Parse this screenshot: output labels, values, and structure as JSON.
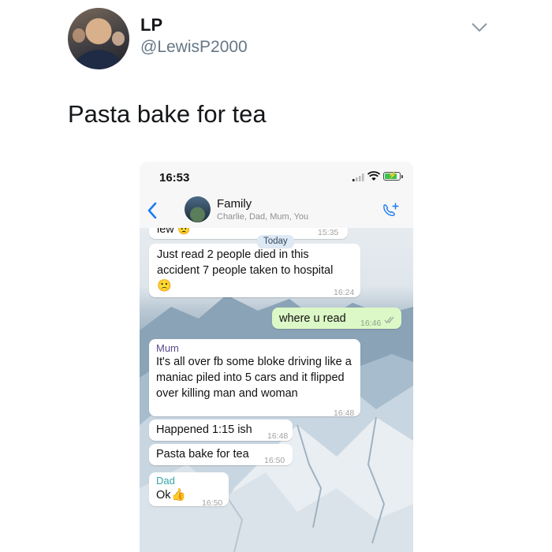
{
  "tweet": {
    "name": "LP",
    "handle": "@LewisP2000",
    "text": "Pasta bake for tea"
  },
  "phone": {
    "status_time": "16:53",
    "chat": {
      "group_name": "Family",
      "members": "Charlie, Dad, Mum, You",
      "date_divider": "Today",
      "messages": [
        {
          "text": "iew",
          "emoji": "😟",
          "time": "15:35",
          "direction": "in"
        },
        {
          "text": "Just read 2 people died in this accident 7 people taken to hospital",
          "emoji": "🙁",
          "time": "16:24",
          "direction": "in"
        },
        {
          "text": "where u read",
          "time": "16:46",
          "direction": "out",
          "status": "read"
        },
        {
          "sender": "Mum",
          "text": "It's all over fb some bloke driving like a maniac piled into 5 cars and it flipped over killing man and woman",
          "time": "16:48",
          "direction": "in"
        },
        {
          "text": "Happened 1:15 ish",
          "time": "16:48",
          "direction": "in"
        },
        {
          "text": "Pasta bake for tea",
          "time": "16:50",
          "direction": "in"
        },
        {
          "sender": "Dad",
          "text": "Ok",
          "emoji": "👍",
          "time": "16:50",
          "direction": "in"
        }
      ]
    }
  },
  "colors": {
    "out_bubble": "#dcf8c6",
    "in_bubble": "#ffffff",
    "ios_blue": "#1b7cf2",
    "mum_name": "#5b4a8c",
    "dad_name": "#35a5a6"
  },
  "icons": [
    "chevron-down-icon",
    "back-chevron-icon",
    "add-call-icon",
    "signal-icon",
    "wifi-icon",
    "battery-icon",
    "double-check-icon"
  ]
}
